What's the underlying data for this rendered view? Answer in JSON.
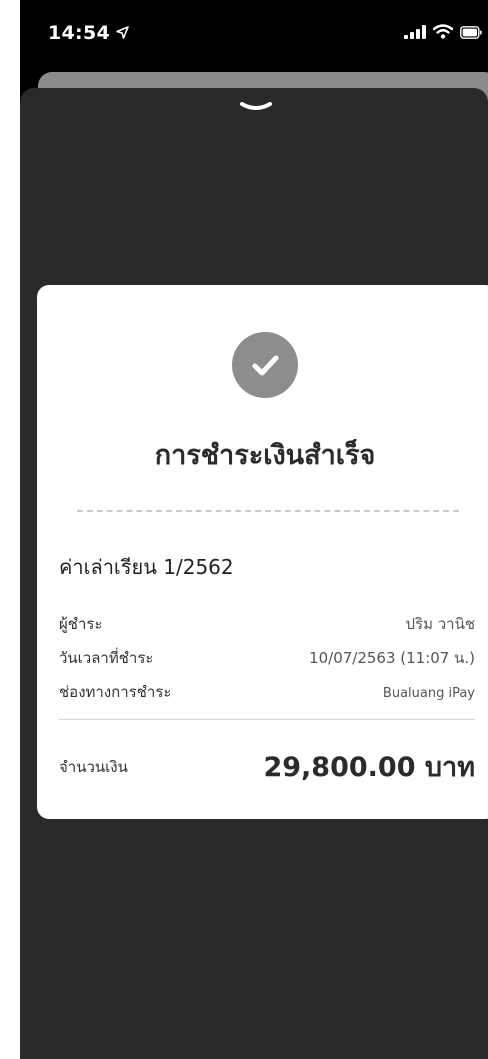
{
  "status_bar": {
    "time": "14:54",
    "icons": [
      "location-arrow-icon",
      "cellular-signal-icon",
      "wifi-icon",
      "battery-icon"
    ]
  },
  "sheet": {
    "dismiss_icon": "chevron-down-icon"
  },
  "receipt": {
    "status_icon": "check-icon",
    "title": "การชำระเงินสำเร็จ",
    "item_title": "ค่าเล่าเรียน 1/2562",
    "rows": [
      {
        "label": "ผู้ชำระ",
        "value": "ปริม วานิช"
      },
      {
        "label": "วันเวลาที่ชำระ",
        "value": "10/07/2563 (11:07 น.)"
      },
      {
        "label": "ช่องทางการชำระ",
        "value": "Bualuang iPay"
      }
    ],
    "amount_label": "จำนวนเงิน",
    "amount_value": "29,800.00 บาท"
  },
  "colors": {
    "background": "#000000",
    "sheet": "#2a2a2a",
    "card": "#ffffff",
    "check_circle": "#8d8d8f",
    "text_primary": "#2b2b2b"
  }
}
